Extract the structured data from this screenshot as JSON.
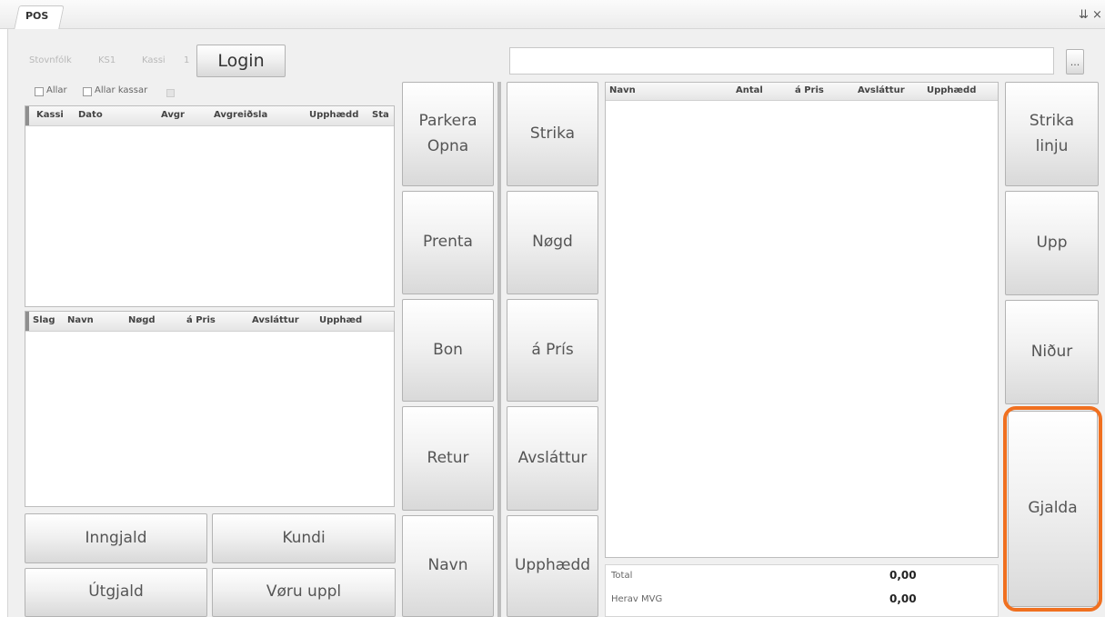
{
  "window": {
    "tab_title": "POS",
    "pin_glyph": "⇊",
    "close_glyph": "×"
  },
  "status": {
    "store_label": "Stovnfólk",
    "store_value": "KS1",
    "register_label": "Kassi",
    "register_value": "1"
  },
  "login_label": "Login",
  "search": {
    "value": "",
    "browse_label": "..."
  },
  "filters": {
    "all_label": "Allar",
    "all_registers_label": "Allar kassar"
  },
  "receipts_table": {
    "columns": [
      "Kassi",
      "Dato",
      "Avgr",
      "Avgreiðsla",
      "Upphædd",
      "Sta"
    ],
    "rows": []
  },
  "lines_table": {
    "columns": [
      "Slag",
      "Navn",
      "Nøgd",
      "á Pris",
      "Avsláttur",
      "Upphæd"
    ],
    "rows": []
  },
  "bottom_buttons": {
    "inngjald": "Inngjald",
    "kundi": "Kundi",
    "utgjald": "Útgjald",
    "voru_uppl": "Vøru uppl"
  },
  "col1_buttons": {
    "parkera": "Parkera\nOpna",
    "prenta": "Prenta",
    "bon": "Bon",
    "retur": "Retur",
    "navn": "Navn"
  },
  "col2_buttons": {
    "strika": "Strika",
    "nogd": "Nøgd",
    "a_pris": "á Prís",
    "avslattur": "Avsláttur",
    "upphaedd": "Upphædd"
  },
  "cart_table": {
    "columns": [
      "Navn",
      "Antal",
      "á Pris",
      "Avsláttur",
      "Upphædd"
    ],
    "rows": []
  },
  "totals": {
    "total_label": "Total",
    "total_value": "0,00",
    "vat_label": "Herav MVG",
    "vat_value": "0,00"
  },
  "right_buttons": {
    "strika_linju": "Strika\nlinju",
    "upp": "Upp",
    "nidur": "Niður",
    "gjalda": "Gjalda"
  },
  "colors": {
    "highlight": "#f07020"
  }
}
